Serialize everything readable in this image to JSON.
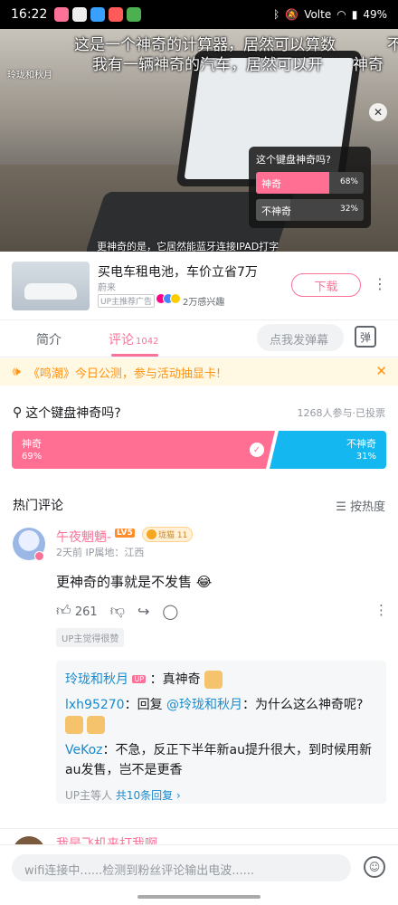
{
  "status": {
    "time": "16:22",
    "signal": "Volte",
    "battery": "49%"
  },
  "video": {
    "uploader_tag": "玲珑和秋月",
    "danmaku": [
      "这是一个神奇的计算器，居然可以算数",
      "我有一辆神奇的汽车，居然可以开",
      "神奇",
      "不"
    ],
    "subtitle": "更神奇的是，它居然能蓝牙连接IPAD打字",
    "poll": {
      "question": "这个键盘神奇吗?",
      "options": [
        {
          "label": "神奇",
          "percent": "68%",
          "fraction": 0.68
        },
        {
          "label": "不神奇",
          "percent": "32%",
          "fraction": 0.32
        }
      ]
    },
    "progress": 0.03
  },
  "ad": {
    "title": "买电车租电池，车价立省7万",
    "brand": "蔚来",
    "tag": "UP主推荐广告",
    "interest": "2万感兴趣",
    "download": "下载",
    "more": "⋮"
  },
  "tabs": {
    "intro": "简介",
    "comments": "评论",
    "comment_count": "1042",
    "danmaku_placeholder": "点我发弹幕",
    "danmaku_icon": "弹"
  },
  "notice": {
    "text": "《鸣潮》今日公测，参与活动抽显卡!",
    "close": "✕"
  },
  "vote": {
    "question": "这个键盘神奇吗?",
    "stats": "1268人参与·已投票",
    "yes_label": "神奇",
    "yes_pct": "69%",
    "yes_fraction": 0.69,
    "no_label": "不神奇",
    "no_pct": "31%"
  },
  "hot": {
    "title": "热门评论",
    "sort": "按热度"
  },
  "comment": {
    "name": "午夜魍魉-",
    "level": "LV5",
    "medal": "珑猫 11",
    "meta": "2天前  IP属地：江西",
    "body": "更神奇的事就是不发售",
    "likes": "261",
    "up_liked": "UP主觉得很赞",
    "replies": [
      {
        "user": "玲珑和秋月",
        "up": "UP",
        "text": "：真神奇"
      },
      {
        "user": "lxh95270",
        "text": "：回复 ",
        "mention": "@玲珑和秋月",
        "rest": "：为什么这么神奇呢?"
      },
      {
        "user": "VeKoz",
        "text": "：不急，反正下半年新au提升很大，到时候用新au发售，岂不是更香"
      }
    ],
    "reply_footer": "UP主等人",
    "reply_count": "共10条回复 ›"
  },
  "next_comment": {
    "name": "我是飞机来打我啊"
  },
  "input": {
    "placeholder": "wifi连接中......检测到粉丝评论输出电波......"
  },
  "colors": {
    "accent": "#fb7299",
    "blue": "#14b7f0",
    "notice": "#ff9212"
  }
}
